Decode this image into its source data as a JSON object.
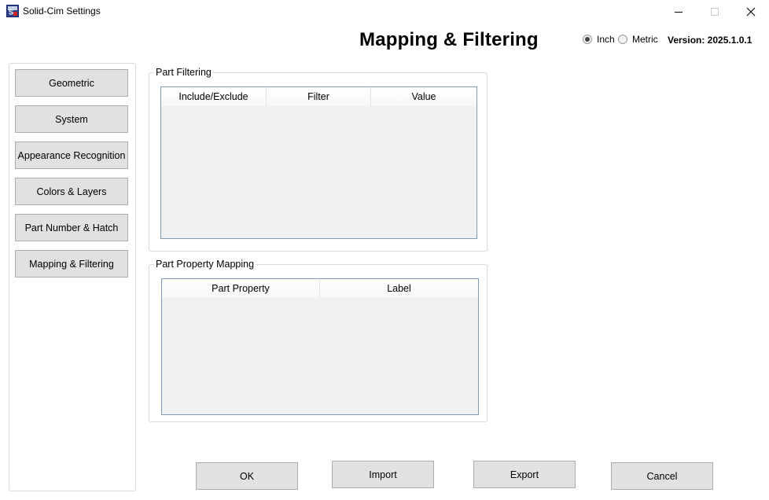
{
  "window": {
    "title": "Solid-Cim Settings",
    "controls": {
      "minimize": "minimize-icon",
      "maximize": "maximize-icon",
      "close": "close-icon"
    }
  },
  "header": {
    "page_title": "Mapping & Filtering",
    "units": {
      "inch_label": "Inch",
      "metric_label": "Metric",
      "selected": "Inch"
    },
    "version": "Version: 2025.1.0.1"
  },
  "nav": {
    "items": [
      {
        "label": "Geometric"
      },
      {
        "label": "System"
      },
      {
        "label": "Appearance Recognition"
      },
      {
        "label": "Colors & Layers"
      },
      {
        "label": "Part Number & Hatch"
      },
      {
        "label": "Mapping & Filtering"
      }
    ]
  },
  "part_filtering": {
    "title": "Part Filtering",
    "columns": [
      "Include/Exclude",
      "Filter",
      "Value"
    ],
    "rows": []
  },
  "part_property_mapping": {
    "title": "Part Property Mapping",
    "columns": [
      "Part Property",
      "Label"
    ],
    "rows": []
  },
  "actions": {
    "ok": "OK",
    "import": "Import",
    "export": "Export",
    "cancel": "Cancel"
  },
  "colors": {
    "button_bg": "#e1e1e1",
    "button_border": "#adadad",
    "grid_border": "#7f9db9",
    "grid_bg": "#f0f0f0"
  }
}
